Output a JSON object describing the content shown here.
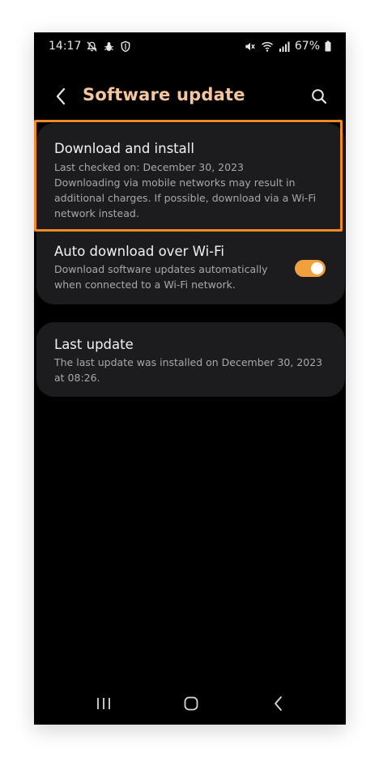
{
  "status": {
    "time": "14:17",
    "left_icons": [
      "notifications-off-icon",
      "bug-icon",
      "shield-icon"
    ],
    "right_icons": [
      "mute-icon",
      "wifi-icon",
      "signal-icon",
      "battery-icon"
    ],
    "battery": "67%"
  },
  "header": {
    "title": "Software update",
    "back_icon": "chevron-left-icon",
    "search_icon": "search-icon"
  },
  "settings": {
    "download": {
      "title": "Download and install",
      "last_checked": "Last checked on: December 30, 2023",
      "note": "Downloading via mobile networks may result in additional charges. If possible, download via a Wi-Fi network instead."
    },
    "auto_download": {
      "title": "Auto download over Wi-Fi",
      "description": "Download software updates automatically when connected to a Wi-Fi network.",
      "enabled": true
    },
    "last_update": {
      "title": "Last update",
      "description": "The last update was installed on December 30, 2023 at 08:26."
    }
  },
  "colors": {
    "accent": "#f5c69d",
    "toggle_on": "#f0a03c",
    "highlight": "#f08a24",
    "card_bg": "#1c1c1e"
  },
  "navigation": {
    "recent_icon": "recent-apps-icon",
    "home_icon": "home-icon",
    "back_icon": "back-icon"
  }
}
